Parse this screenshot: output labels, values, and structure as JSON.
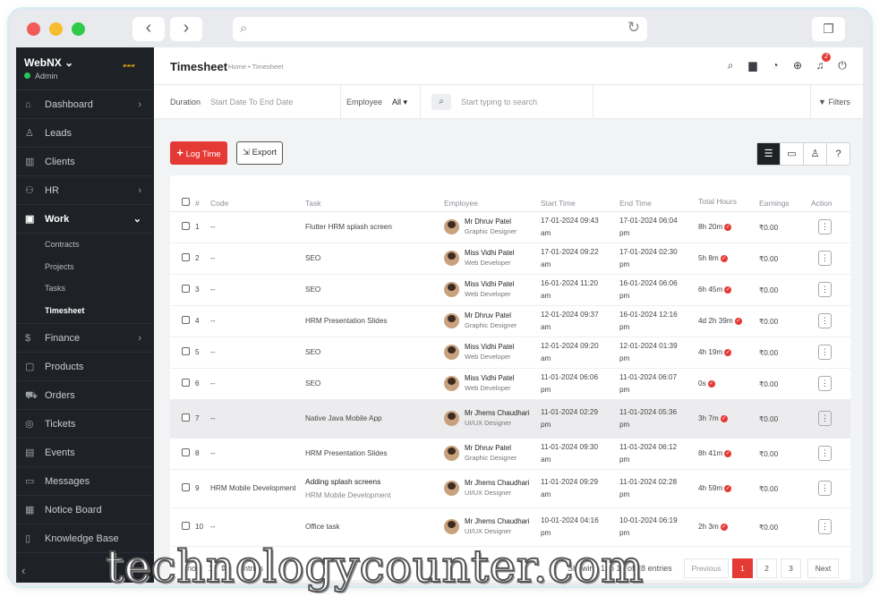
{
  "browser": {
    "back": "‹",
    "forward": "›"
  },
  "sidebar": {
    "company": "WebNX",
    "role": "Admin",
    "logo_text": "",
    "items": [
      {
        "label": "Dashboard",
        "icon": "home-icon",
        "chev": "›"
      },
      {
        "label": "Leads",
        "icon": "user-icon",
        "chev": ""
      },
      {
        "label": "Clients",
        "icon": "chart-icon",
        "chev": ""
      },
      {
        "label": "HR",
        "icon": "hr-icon",
        "chev": "›"
      },
      {
        "label": "Work",
        "icon": "briefcase-icon",
        "chev": "⌄"
      }
    ],
    "subitems": [
      "Contracts",
      "Projects",
      "Tasks",
      "Timesheet"
    ],
    "items2": [
      {
        "label": "Finance",
        "icon": "dollar-icon",
        "chev": "›"
      },
      {
        "label": "Products",
        "icon": "box-icon",
        "chev": ""
      },
      {
        "label": "Orders",
        "icon": "cart-icon",
        "chev": ""
      },
      {
        "label": "Tickets",
        "icon": "ticket-icon",
        "chev": ""
      },
      {
        "label": "Events",
        "icon": "calendar-icon",
        "chev": ""
      },
      {
        "label": "Messages",
        "icon": "message-icon",
        "chev": ""
      },
      {
        "label": "Notice Board",
        "icon": "notice-icon",
        "chev": ""
      },
      {
        "label": "Knowledge Base",
        "icon": "book-icon",
        "chev": ""
      }
    ]
  },
  "header": {
    "title": "Timesheet",
    "breadcrumb": "Home • Timesheet",
    "notif_count": "2"
  },
  "filters": {
    "duration_label": "Duration",
    "duration_value": "Start Date To End Date",
    "employee_label": "Employee",
    "employee_value": "All",
    "search_placeholder": "Start typing to search",
    "filters_label": "Filters"
  },
  "actions": {
    "log_time": "Log Time",
    "export": "Export"
  },
  "table": {
    "headers": [
      "#",
      "Code",
      "Task",
      "Employee",
      "Start Time",
      "End Time",
      "Total Hours",
      "Earnings",
      "Action"
    ],
    "rows": [
      {
        "n": "1",
        "code": "--",
        "task": "Flutter HRM splash screen",
        "task_sub": "",
        "emp": "Mr Dhruv Patel",
        "role": "Graphic Designer",
        "start": "17-01-2024 09:43",
        "start2": "am",
        "end": "17-01-2024 06:04",
        "end2": "pm",
        "hours": "8h 20m",
        "earn": "₹0.00"
      },
      {
        "n": "2",
        "code": "--",
        "task": "SEO",
        "task_sub": "",
        "emp": "Miss Vidhi Patel",
        "role": "Web Developer",
        "start": "17-01-2024 09:22",
        "start2": "am",
        "end": "17-01-2024 02:30",
        "end2": "pm",
        "hours": "5h 8m",
        "earn": "₹0.00"
      },
      {
        "n": "3",
        "code": "--",
        "task": "SEO",
        "task_sub": "",
        "emp": "Miss Vidhi Patel",
        "role": "Web Developer",
        "start": "16-01-2024 11:20",
        "start2": "am",
        "end": "16-01-2024 06:06",
        "end2": "pm",
        "hours": "6h 45m",
        "earn": "₹0.00"
      },
      {
        "n": "4",
        "code": "--",
        "task": "HRM Presentation Slides",
        "task_sub": "",
        "emp": "Mr Dhruv Patel",
        "role": "Graphic Designer",
        "start": "12-01-2024 09:37",
        "start2": "am",
        "end": "16-01-2024 12:16",
        "end2": "pm",
        "hours": "4d 2h 39m",
        "earn": "₹0.00"
      },
      {
        "n": "5",
        "code": "--",
        "task": "SEO",
        "task_sub": "",
        "emp": "Miss Vidhi Patel",
        "role": "Web Developer",
        "start": "12-01-2024 09:20",
        "start2": "am",
        "end": "12-01-2024 01:39",
        "end2": "pm",
        "hours": "4h 19m",
        "earn": "₹0.00"
      },
      {
        "n": "6",
        "code": "--",
        "task": "SEO",
        "task_sub": "",
        "emp": "Miss Vidhi Patel",
        "role": "Web Developer",
        "start": "11-01-2024 06:06",
        "start2": "pm",
        "end": "11-01-2024 06:07",
        "end2": "pm",
        "hours": "0s",
        "earn": "₹0.00"
      },
      {
        "n": "7",
        "code": "--",
        "task": "Native Java Mobile App",
        "task_sub": "",
        "emp": "Mr Jhems Chaudhari",
        "role": "UI/UX Designer",
        "start": "11-01-2024 02:29",
        "start2": "pm",
        "end": "11-01-2024 05:36",
        "end2": "pm",
        "hours": "3h 7m",
        "earn": "₹0.00"
      },
      {
        "n": "8",
        "code": "--",
        "task": "HRM Presentation Slides",
        "task_sub": "",
        "emp": "Mr Dhruv Patel",
        "role": "Graphic Designer",
        "start": "11-01-2024 09:30",
        "start2": "am",
        "end": "11-01-2024 06:12",
        "end2": "pm",
        "hours": "8h 41m",
        "earn": "₹0.00"
      },
      {
        "n": "9",
        "code": "HRM Mobile Development",
        "task": "Adding splash screens",
        "task_sub": "HRM Mobile Development",
        "emp": "Mr Jhems Chaudhari",
        "role": "UI/UX Designer",
        "start": "11-01-2024 09:29",
        "start2": "am",
        "end": "11-01-2024 02:28",
        "end2": "pm",
        "hours": "4h 59m",
        "earn": "₹0.00"
      },
      {
        "n": "10",
        "code": "--",
        "task": "Office task",
        "task_sub": "",
        "emp": "Mr Jhems Chaudhari",
        "role": "UI/UX Designer",
        "start": "10-01-2024 04:16",
        "start2": "pm",
        "end": "10-01-2024 06:19",
        "end2": "pm",
        "hours": "2h 3m",
        "earn": "₹0.00"
      }
    ]
  },
  "footer": {
    "show": "Show",
    "per_page": "10",
    "entries": "entries",
    "showing": "Showing 1 to 10 of 28 entries",
    "prev": "Previous",
    "pages": [
      "1",
      "2",
      "3"
    ],
    "next": "Next"
  },
  "watermark": "technologycounter.com",
  "colors": {
    "accent": "#e53935",
    "sidebar": "#1e2227"
  }
}
